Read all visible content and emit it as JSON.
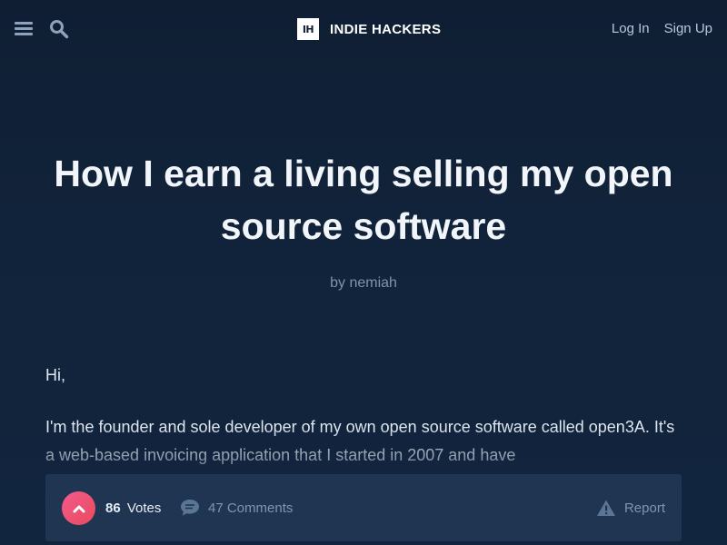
{
  "header": {
    "brand_logo": "IH",
    "brand_name": "INDIE HACKERS",
    "login_label": "Log In",
    "signup_label": "Sign Up"
  },
  "post": {
    "title": "How I earn a living selling my open source software",
    "by_prefix": "by",
    "author": "nemiah",
    "greeting": "Hi,",
    "paragraph": "I'm the founder and sole developer of my own open source software called open3A. It's a web-based invoicing application that I started in 2007 and have"
  },
  "actions": {
    "vote_count": "86",
    "votes_label": "Votes",
    "comments_label": "47 Comments",
    "report_label": "Report"
  },
  "icons": {
    "menu": "menu-icon",
    "search": "search-icon",
    "upvote": "chevron-up-icon",
    "comment": "speech-bubble-icon",
    "report": "warning-triangle-icon"
  },
  "colors": {
    "background": "#0f1f33",
    "upvote_accent": "#f0547b",
    "bar": "#1f3552",
    "muted_text": "#7f95ad"
  }
}
